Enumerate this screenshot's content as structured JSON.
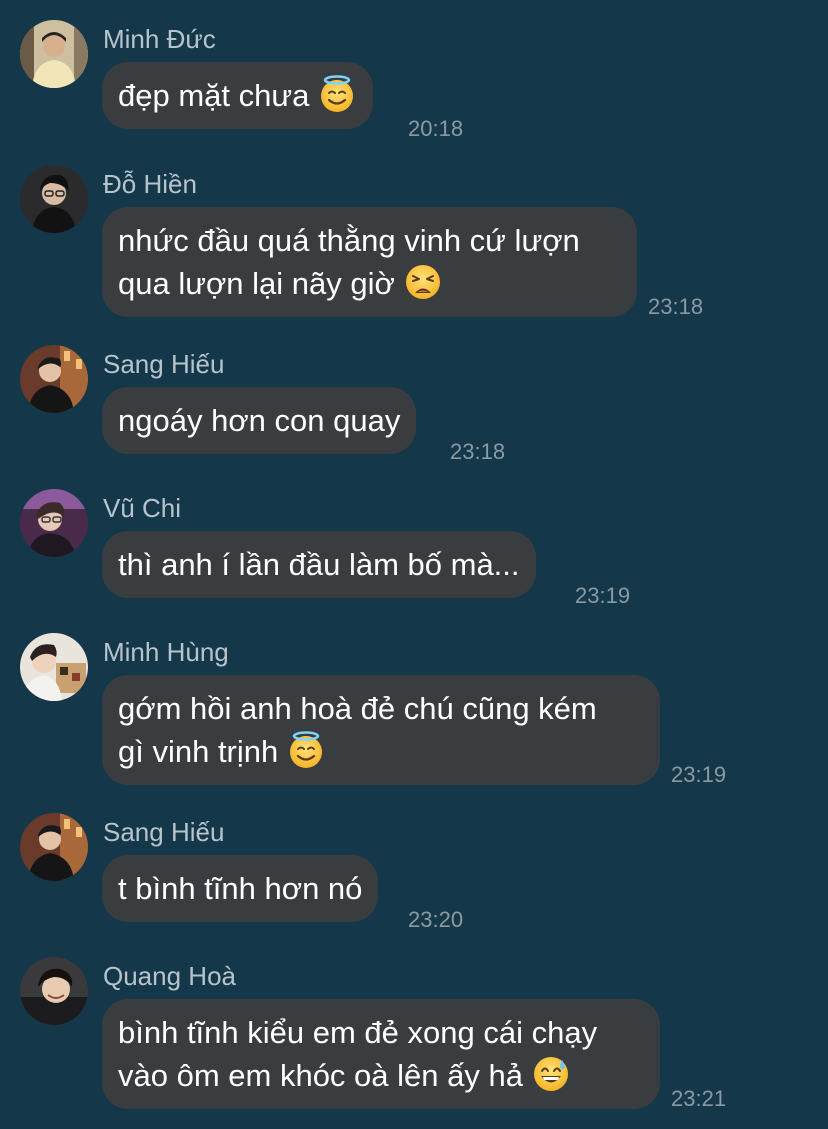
{
  "colors": {
    "background": "#14374a",
    "bubble": "#3a3d40",
    "sender_name": "#b7c4cc",
    "timestamp": "#8a9aa3"
  },
  "messages": [
    {
      "sender": "Minh Đức",
      "avatar_icon": "user-avatar-photo",
      "lines": [
        "đẹp mặt chưa"
      ],
      "emoji": "smiling-face-with-halo-emoji",
      "time": "20:18"
    },
    {
      "sender": "Đỗ Hiền",
      "avatar_icon": "user-avatar-photo",
      "lines": [
        "nhức đầu quá thằng vinh cứ lượn",
        "qua lượn lại nãy giờ"
      ],
      "emoji": "weary-face-emoji",
      "time": "23:18"
    },
    {
      "sender": "Sang Hiếu",
      "avatar_icon": "user-avatar-photo",
      "lines": [
        "ngoáy hơn con quay"
      ],
      "emoji": "",
      "time": "23:18"
    },
    {
      "sender": "Vũ Chi",
      "avatar_icon": "user-avatar-photo",
      "lines": [
        "thì anh í lần đầu làm bố mà..."
      ],
      "emoji": "",
      "time": "23:19"
    },
    {
      "sender": "Minh Hùng",
      "avatar_icon": "user-avatar-photo",
      "lines": [
        "gớm hồi anh hoà đẻ chú cũng kém",
        "gì vinh trịnh"
      ],
      "emoji": "smiling-face-with-halo-emoji",
      "time": "23:19"
    },
    {
      "sender": "Sang Hiếu",
      "avatar_icon": "user-avatar-photo",
      "lines": [
        "t bình tĩnh hơn nó"
      ],
      "emoji": "",
      "time": "23:20"
    },
    {
      "sender": "Quang Hoà",
      "avatar_icon": "user-avatar-photo",
      "lines": [
        "bình tĩnh kiểu em đẻ xong cái chạy",
        "vào ôm em khóc oà lên ấy hả"
      ],
      "emoji": "grinning-face-with-sweat-emoji",
      "time": "23:21"
    }
  ]
}
